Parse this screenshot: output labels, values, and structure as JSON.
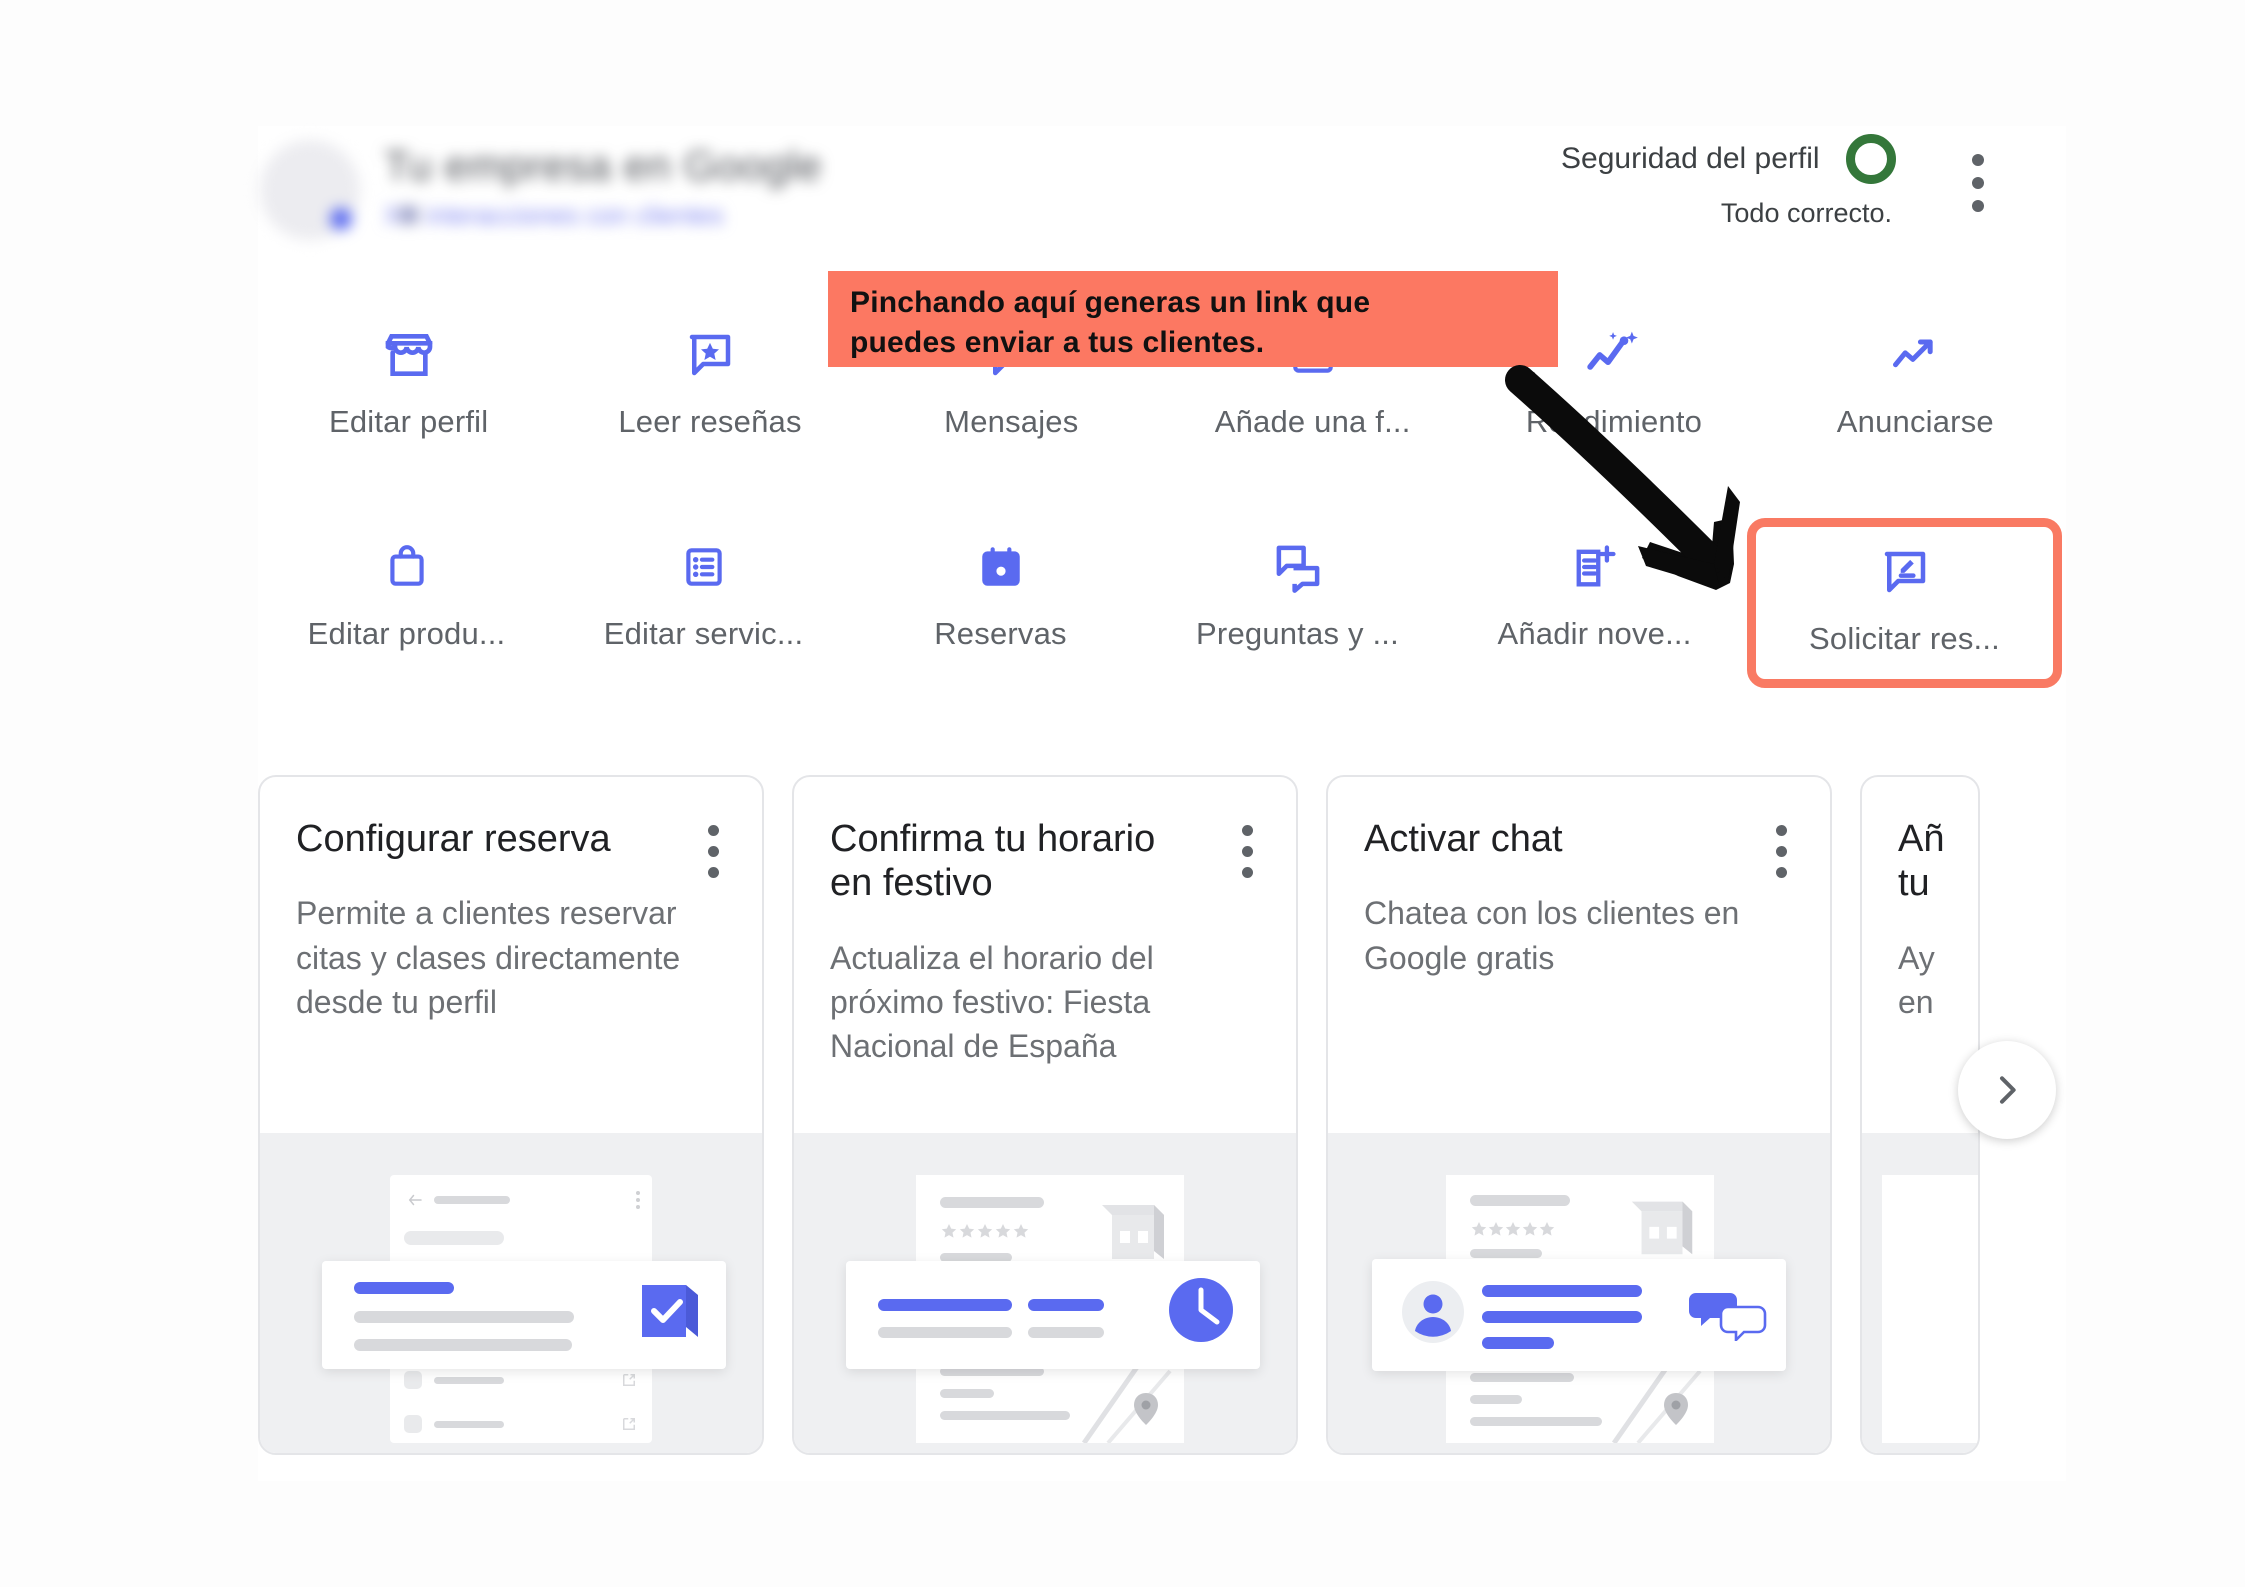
{
  "header": {
    "business_name": "Tu empresa en Google",
    "business_sub": "XX interacciones con clientes",
    "security_label": "Seguridad del perfil",
    "security_status": "Todo correcto.",
    "security_color": "#34773a",
    "overflow_icon": "more-vert-icon"
  },
  "actions": {
    "row1": [
      {
        "label": "Editar perfil",
        "icon": "storefront-icon"
      },
      {
        "label": "Leer reseñas",
        "icon": "review-star-bubble-icon"
      },
      {
        "label": "Mensajes",
        "icon": "message-bubble-icon"
      },
      {
        "label": "Añade una f...",
        "icon": "add-photo-icon"
      },
      {
        "label": "Rendimiento",
        "icon": "performance-sparkle-icon"
      },
      {
        "label": "Anunciarse",
        "icon": "trending-up-icon"
      }
    ],
    "row2": [
      {
        "label": "Editar produ...",
        "icon": "shopping-bag-icon",
        "highlighted": false
      },
      {
        "label": "Editar servic...",
        "icon": "list-box-icon",
        "highlighted": false
      },
      {
        "label": "Reservas",
        "icon": "calendar-icon",
        "highlighted": false
      },
      {
        "label": "Preguntas y ...",
        "icon": "qa-bubbles-icon",
        "highlighted": false
      },
      {
        "label": "Añadir nove...",
        "icon": "post-add-icon",
        "highlighted": false
      },
      {
        "label": "Solicitar res...",
        "icon": "request-review-icon",
        "highlighted": true
      }
    ]
  },
  "cards": [
    {
      "title": "Configurar reserva",
      "description": "Permite a clientes reservar citas y clases directamente desde tu perfil",
      "menu_icon": "more-vert-icon",
      "illustration": "booking-confirm-illustration"
    },
    {
      "title": "Confirma tu horario en festivo",
      "description": "Actualiza el horario del próximo festivo: Fiesta Nacional de España",
      "menu_icon": "more-vert-icon",
      "illustration": "holiday-hours-clock-illustration"
    },
    {
      "title": "Activar chat",
      "description": "Chatea con los clientes en Google gratis",
      "menu_icon": "more-vert-icon",
      "illustration": "chat-activate-illustration"
    },
    {
      "title": "Añ tu",
      "description": "Ay en",
      "menu_icon": "more-vert-icon",
      "illustration": "clipped-illustration"
    }
  ],
  "carousel": {
    "next_icon": "chevron-right-icon",
    "next_label": "Siguiente"
  },
  "annotation": {
    "banner_line1": "Pinchando aquí generas un link que",
    "banner_line2": "puedes enviar a tus clientes.",
    "banner_color": "#fc7862",
    "highlight_color": "#f97a63",
    "arrow_icon": "pointing-arrow"
  },
  "theme": {
    "accent_blue": "#5a6af0",
    "text_primary": "#202124",
    "text_secondary": "#5f6368"
  }
}
